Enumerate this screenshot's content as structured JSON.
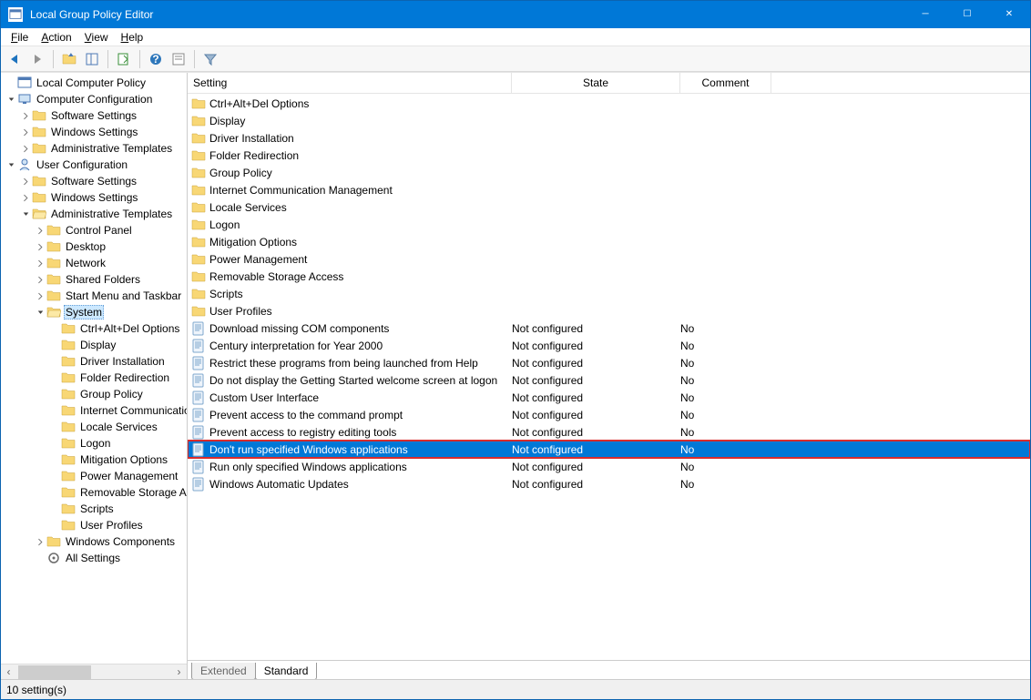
{
  "window": {
    "title": "Local Group Policy Editor"
  },
  "menus": {
    "file": "File",
    "action": "Action",
    "view": "View",
    "help": "Help"
  },
  "status": "10 setting(s)",
  "columns": {
    "setting": "Setting",
    "state": "State",
    "comment": "Comment"
  },
  "tabs": {
    "extended": "Extended",
    "standard": "Standard"
  },
  "tree": {
    "root": "Local Computer Policy",
    "compConfig": "Computer Configuration",
    "userConfig": "User Configuration",
    "softSettings": "Software Settings",
    "winSettings": "Windows Settings",
    "adminTemplates": "Administrative Templates",
    "controlPanel": "Control Panel",
    "desktop": "Desktop",
    "network": "Network",
    "sharedFolders": "Shared Folders",
    "startMenu": "Start Menu and Taskbar",
    "system": "System",
    "ctrlAltDel": "Ctrl+Alt+Del Options",
    "display": "Display",
    "driverInst": "Driver Installation",
    "folderRedir": "Folder Redirection",
    "groupPolicy": "Group Policy",
    "internetComm": "Internet Communication Management",
    "localeSvc": "Locale Services",
    "logon": "Logon",
    "mitigation": "Mitigation Options",
    "powerMgmt": "Power Management",
    "removableStorage": "Removable Storage Access",
    "scripts": "Scripts",
    "userProfiles": "User Profiles",
    "winComponents": "Windows Components",
    "allSettings": "All Settings"
  },
  "state_nc": "Not configured",
  "comment_no": "No",
  "settings": {
    "folders": [
      "Ctrl+Alt+Del Options",
      "Display",
      "Driver Installation",
      "Folder Redirection",
      "Group Policy",
      "Internet Communication Management",
      "Locale Services",
      "Logon",
      "Mitigation Options",
      "Power Management",
      "Removable Storage Access",
      "Scripts",
      "User Profiles"
    ],
    "policies": [
      "Download missing COM components",
      "Century interpretation for Year 2000",
      "Restrict these programs from being launched from Help",
      "Do not display the Getting Started welcome screen at logon",
      "Custom User Interface",
      "Prevent access to the command prompt",
      "Prevent access to registry editing tools",
      "Don't run specified Windows applications",
      "Run only specified Windows applications",
      "Windows Automatic Updates"
    ],
    "selected_index": 7
  }
}
